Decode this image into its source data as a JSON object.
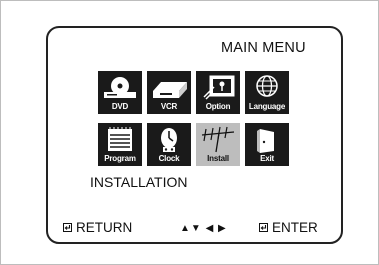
{
  "menu": {
    "title": "MAIN MENU",
    "items": [
      {
        "label": "DVD",
        "icon": "dvd-player-icon"
      },
      {
        "label": "VCR",
        "icon": "vcr-icon"
      },
      {
        "label": "Option",
        "icon": "option-icon"
      },
      {
        "label": "Language",
        "icon": "globe-icon"
      },
      {
        "label": "Program",
        "icon": "calendar-icon"
      },
      {
        "label": "Clock",
        "icon": "clock-icon"
      },
      {
        "label": "Install",
        "icon": "antenna-icon",
        "selected": true
      },
      {
        "label": "Exit",
        "icon": "exit-door-icon"
      }
    ],
    "selected_section": "INSTALLATION"
  },
  "footer": {
    "return_label": "RETURN",
    "nav_arrows": "▲▼ ◀ ▶",
    "enter_label": "ENTER"
  },
  "colors": {
    "tile_bg": "#1a1a1a",
    "tile_selected_bg": "#bdbdbd",
    "panel_border": "#222222"
  }
}
